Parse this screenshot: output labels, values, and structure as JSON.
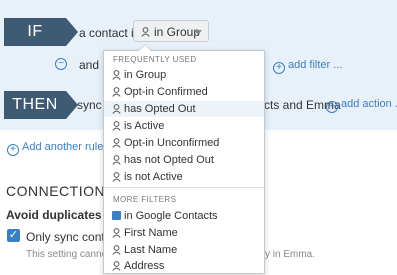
{
  "rule": {
    "if_label": "IF",
    "then_label": "THEN",
    "contact_text": "a contact is",
    "selected_value": "in Group",
    "and_text": "and",
    "add_filter_label": "add filter ...",
    "then_text": "sync t",
    "then_right_text": "cts and Emma",
    "add_action_label": "add action ...",
    "add_rule_label": "Add another rule ."
  },
  "connection": {
    "title": "CONNECTION",
    "avoid_label": "Avoid duplicates",
    "checkbox_label": "Only sync contac",
    "checkbox_checked": true,
    "note_left": "This setting canno",
    "note_right": "y in Emma."
  },
  "dropdown": {
    "frequent_header": "FREQUENTLY USED",
    "frequent_items": [
      {
        "label": "in Group",
        "icon": "person-icon"
      },
      {
        "label": "Opt-in Confirmed",
        "icon": "person-icon"
      },
      {
        "label": "has Opted Out",
        "icon": "person-icon",
        "highlighted": true
      },
      {
        "label": "is Active",
        "icon": "person-icon"
      },
      {
        "label": "Opt-in Unconfirmed",
        "icon": "person-icon"
      },
      {
        "label": "has not Opted Out",
        "icon": "person-icon"
      },
      {
        "label": "is not Active",
        "icon": "person-icon"
      }
    ],
    "more_header": "MORE FILTERS",
    "more_items": [
      {
        "label": "in Google Contacts",
        "icon": "google-contacts-icon"
      },
      {
        "label": "First Name",
        "icon": "person-icon"
      },
      {
        "label": "Last Name",
        "icon": "person-icon"
      },
      {
        "label": "Address",
        "icon": "person-icon"
      }
    ]
  },
  "colors": {
    "panel_bg": "#e8f1fa",
    "tag_bg": "#3f5a73",
    "link": "#3a7fc1"
  }
}
